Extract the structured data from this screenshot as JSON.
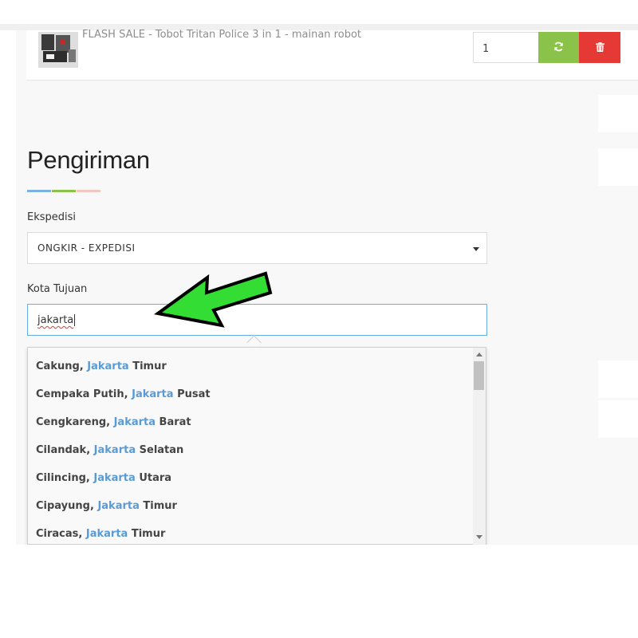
{
  "cart": {
    "product_name": "FLASH SALE - Tobot Tritan Police 3 in 1 - mainan robot",
    "quantity": "1",
    "update_icon": "refresh-icon",
    "delete_icon": "trash-icon",
    "colors": {
      "update": "#8bc34a",
      "delete": "#e53935"
    }
  },
  "shipping": {
    "title": "Pengiriman",
    "accent_colors": [
      "#7cb2e3",
      "#8bc34a",
      "#f0c8c0"
    ],
    "courier_label": "Ekspedisi",
    "courier_value": "ONGKIR - EXPEDISI",
    "city_label": "Kota Tujuan",
    "city_value": "jakarta"
  },
  "suggestions": [
    {
      "district": "Cakung, ",
      "match": "Jakarta",
      "area": " Timur"
    },
    {
      "district": "Cempaka Putih, ",
      "match": "Jakarta",
      "area": " Pusat"
    },
    {
      "district": "Cengkareng, ",
      "match": "Jakarta",
      "area": " Barat"
    },
    {
      "district": "Cilandak, ",
      "match": "Jakarta",
      "area": " Selatan"
    },
    {
      "district": "Cilincing, ",
      "match": "Jakarta",
      "area": " Utara"
    },
    {
      "district": "Cipayung, ",
      "match": "Jakarta",
      "area": " Timur"
    },
    {
      "district": "Ciracas, ",
      "match": "Jakarta",
      "area": " Timur"
    }
  ],
  "annotation": {
    "arrow_color": "#33dd33",
    "arrow_icon": "green-pointer-arrow"
  }
}
